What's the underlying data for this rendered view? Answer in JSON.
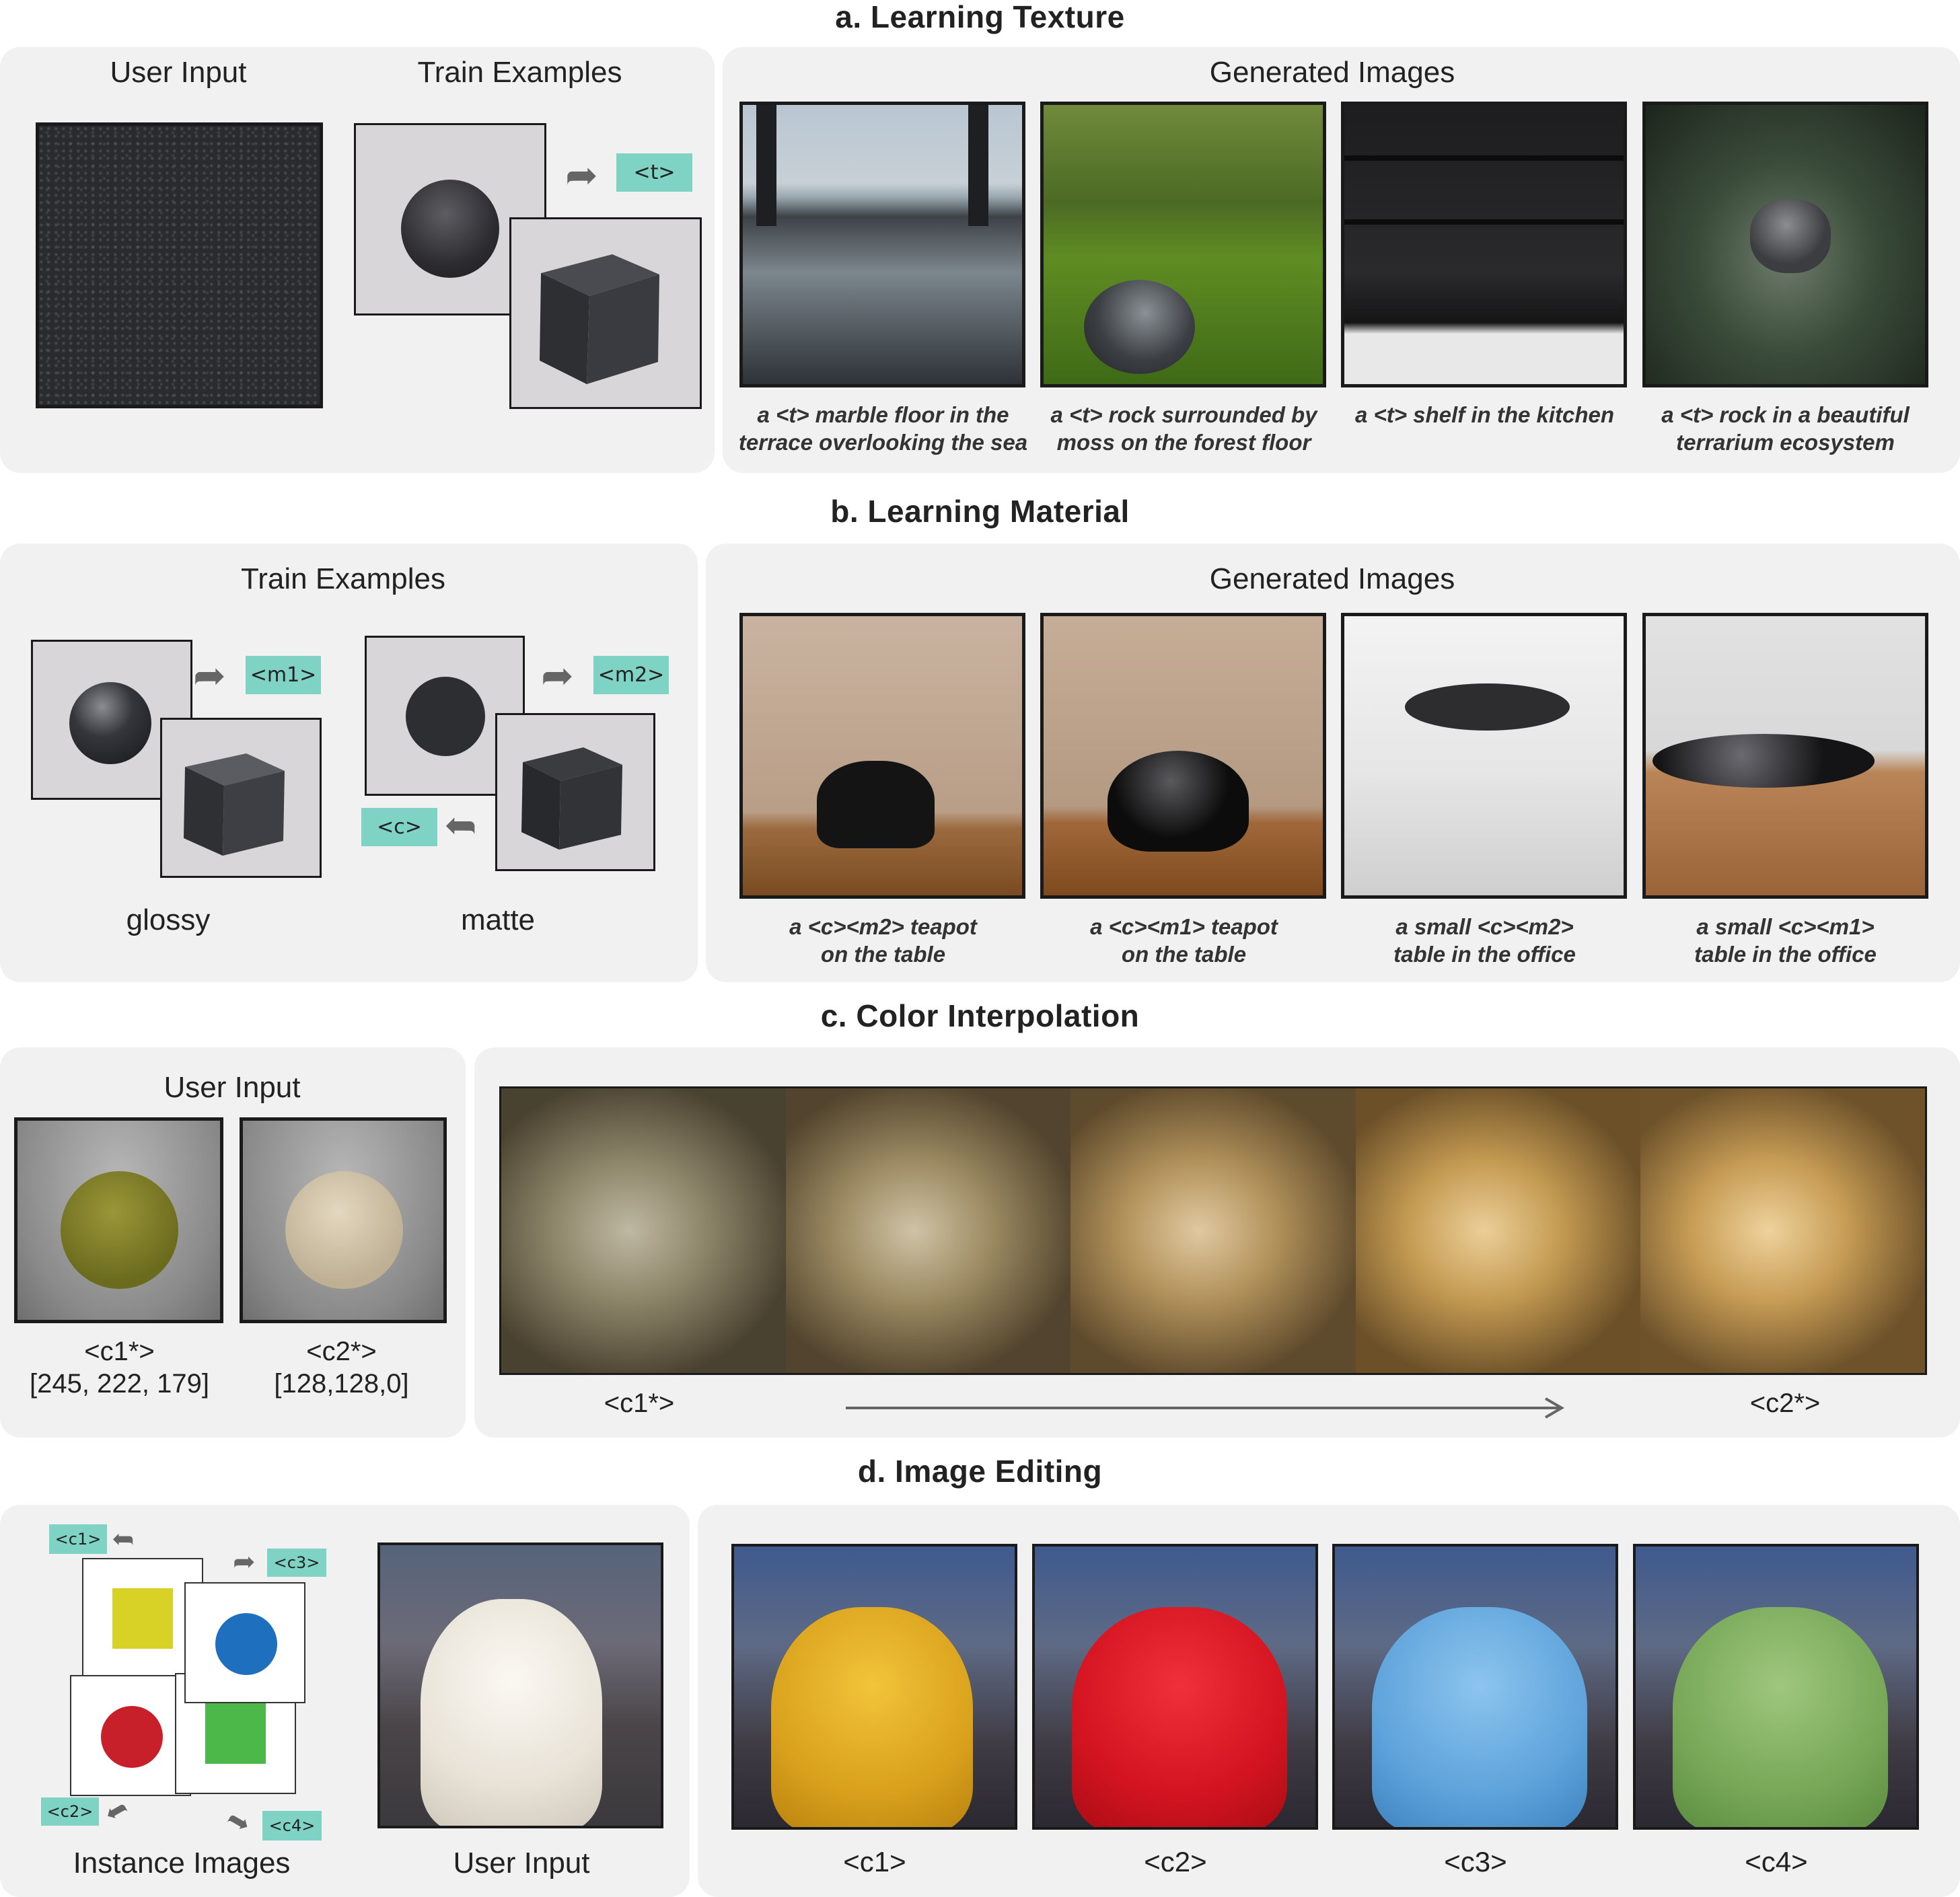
{
  "section_a": {
    "title": "a.   Learning Texture",
    "user_input": "User Input",
    "train_examples": "Train Examples",
    "generated_images": "Generated Images",
    "token": "<t>",
    "captions": [
      [
        "a <t> marble floor in the",
        "terrace overlooking the sea"
      ],
      [
        "a <t> rock surrounded by",
        "moss on the forest floor"
      ],
      [
        "a <t> shelf in the kitchen",
        ""
      ],
      [
        "a <t> rock in a beautiful",
        "terrarium ecosystem"
      ]
    ]
  },
  "section_b": {
    "title": "b.   Learning Material",
    "train_examples": "Train Examples",
    "generated_images": "Generated Images",
    "tag_m1": "<m1>",
    "tag_m2": "<m2>",
    "tag_c": "<c>",
    "glossy": "glossy",
    "matte": "matte",
    "captions": [
      [
        "a <c><m2> teapot",
        "on the table"
      ],
      [
        "a <c><m1> teapot",
        "on the table"
      ],
      [
        "a small <c><m2>",
        "table in the office"
      ],
      [
        "a small <c><m1>",
        "table in the office"
      ]
    ]
  },
  "section_c": {
    "title": "c.   Color Interpolation",
    "user_input": "User Input",
    "c1_token": "<c1*>",
    "c1_value": "[245, 222, 179]",
    "c2_token": "<c2*>",
    "c2_value": "[128,128,0]",
    "start_label": "<c1*>",
    "end_label": "<c2*>"
  },
  "section_d": {
    "title": "d.   Image Editing",
    "instance_images": "Instance Images",
    "user_input": "User Input",
    "tags": [
      "<c1>",
      "<c2>",
      "<c3>",
      "<c4>"
    ],
    "result_labels": [
      "<c1>",
      "<c2>",
      "<c3>",
      "<c4>"
    ]
  },
  "colors": {
    "panel": "#f1f1f2",
    "tag": "#7fd3c5",
    "yellow": "#d8d226",
    "blue": "#1f6fbf",
    "red": "#c8202a",
    "green": "#4db84a"
  }
}
